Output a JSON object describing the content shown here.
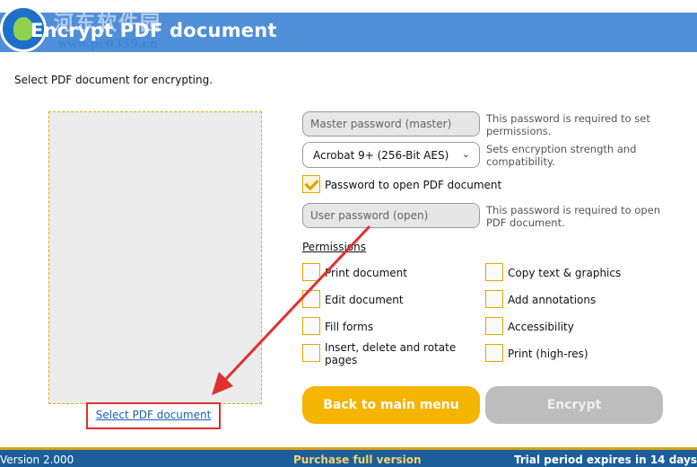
{
  "window": {
    "title": "Encrypt PDF document"
  },
  "watermark": {
    "site_cn": "河东软件园",
    "url": "www.pc0359.cn"
  },
  "instruction": "Select PDF document for encrypting.",
  "preview": {
    "select_link": "Select PDF document"
  },
  "master_password": {
    "placeholder": "Master password (master)",
    "hint": "This password is required to set permissions."
  },
  "encryption": {
    "selected": "Acrobat 9+ (256-Bit AES)",
    "hint": "Sets encryption strength and compatibility."
  },
  "open_password": {
    "checkbox_label": "Password to open PDF document",
    "checked": true
  },
  "user_password": {
    "placeholder": "User password (open)",
    "hint": "This password is required to open PDF document."
  },
  "permissions": {
    "heading": "Permissions",
    "left": [
      "Print document",
      "Edit document",
      "Fill forms",
      "Insert, delete and rotate pages"
    ],
    "right": [
      "Copy text & graphics",
      "Add annotations",
      "Accessibility",
      "Print (high-res)"
    ]
  },
  "buttons": {
    "back": "Back to main menu",
    "encrypt": "Encrypt"
  },
  "footer": {
    "version": "Version 2.000",
    "purchase": "Purchase full version",
    "trial": "Trial period expires in 14 days"
  },
  "colors": {
    "accent": "#f4b400",
    "header": "#4f8fd8",
    "footer": "#1a5f9c",
    "annotation": "#e03030"
  }
}
